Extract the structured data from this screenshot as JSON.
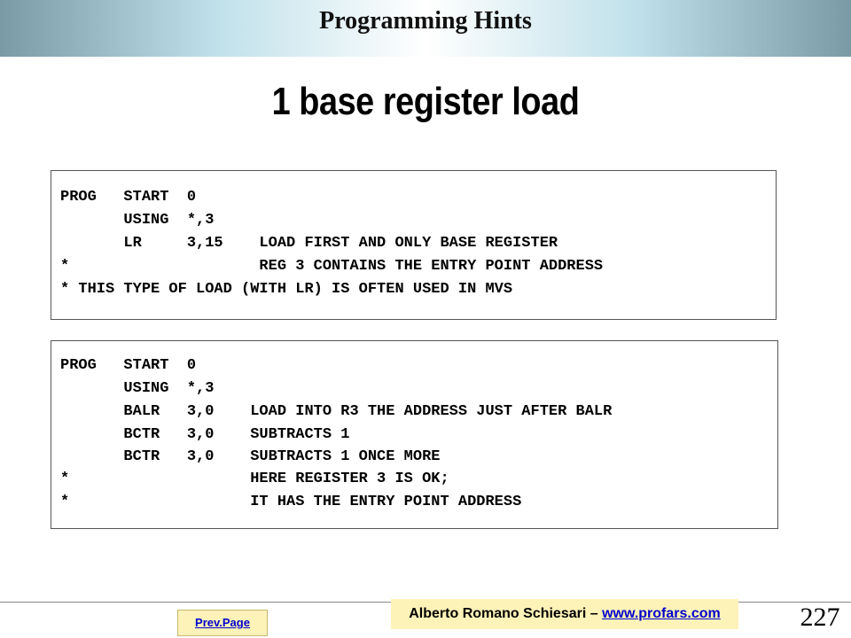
{
  "header": {
    "title": "Programming Hints"
  },
  "slide": {
    "title": "1 base register load"
  },
  "code_blocks": [
    {
      "lines": [
        "PROG   START  0",
        "       USING  *,3",
        "       LR     3,15    LOAD FIRST AND ONLY BASE REGISTER",
        "*                     REG 3 CONTAINS THE ENTRY POINT ADDRESS",
        "* THIS TYPE OF LOAD (WITH LR) IS OFTEN USED IN MVS"
      ]
    },
    {
      "lines": [
        "PROG   START  0",
        "       USING  *,3",
        "       BALR   3,0    LOAD INTO R3 THE ADDRESS JUST AFTER BALR",
        "       BCTR   3,0    SUBTRACTS 1",
        "       BCTR   3,0    SUBTRACTS 1 ONCE MORE",
        "*                    HERE REGISTER 3 IS OK;",
        "*                    IT HAS THE ENTRY POINT ADDRESS"
      ]
    }
  ],
  "footer": {
    "prev_page_label": "Prev.Page",
    "author_text": "Alberto Romano Schiesari – ",
    "author_link": "www.profars.com",
    "page_number": "227"
  }
}
